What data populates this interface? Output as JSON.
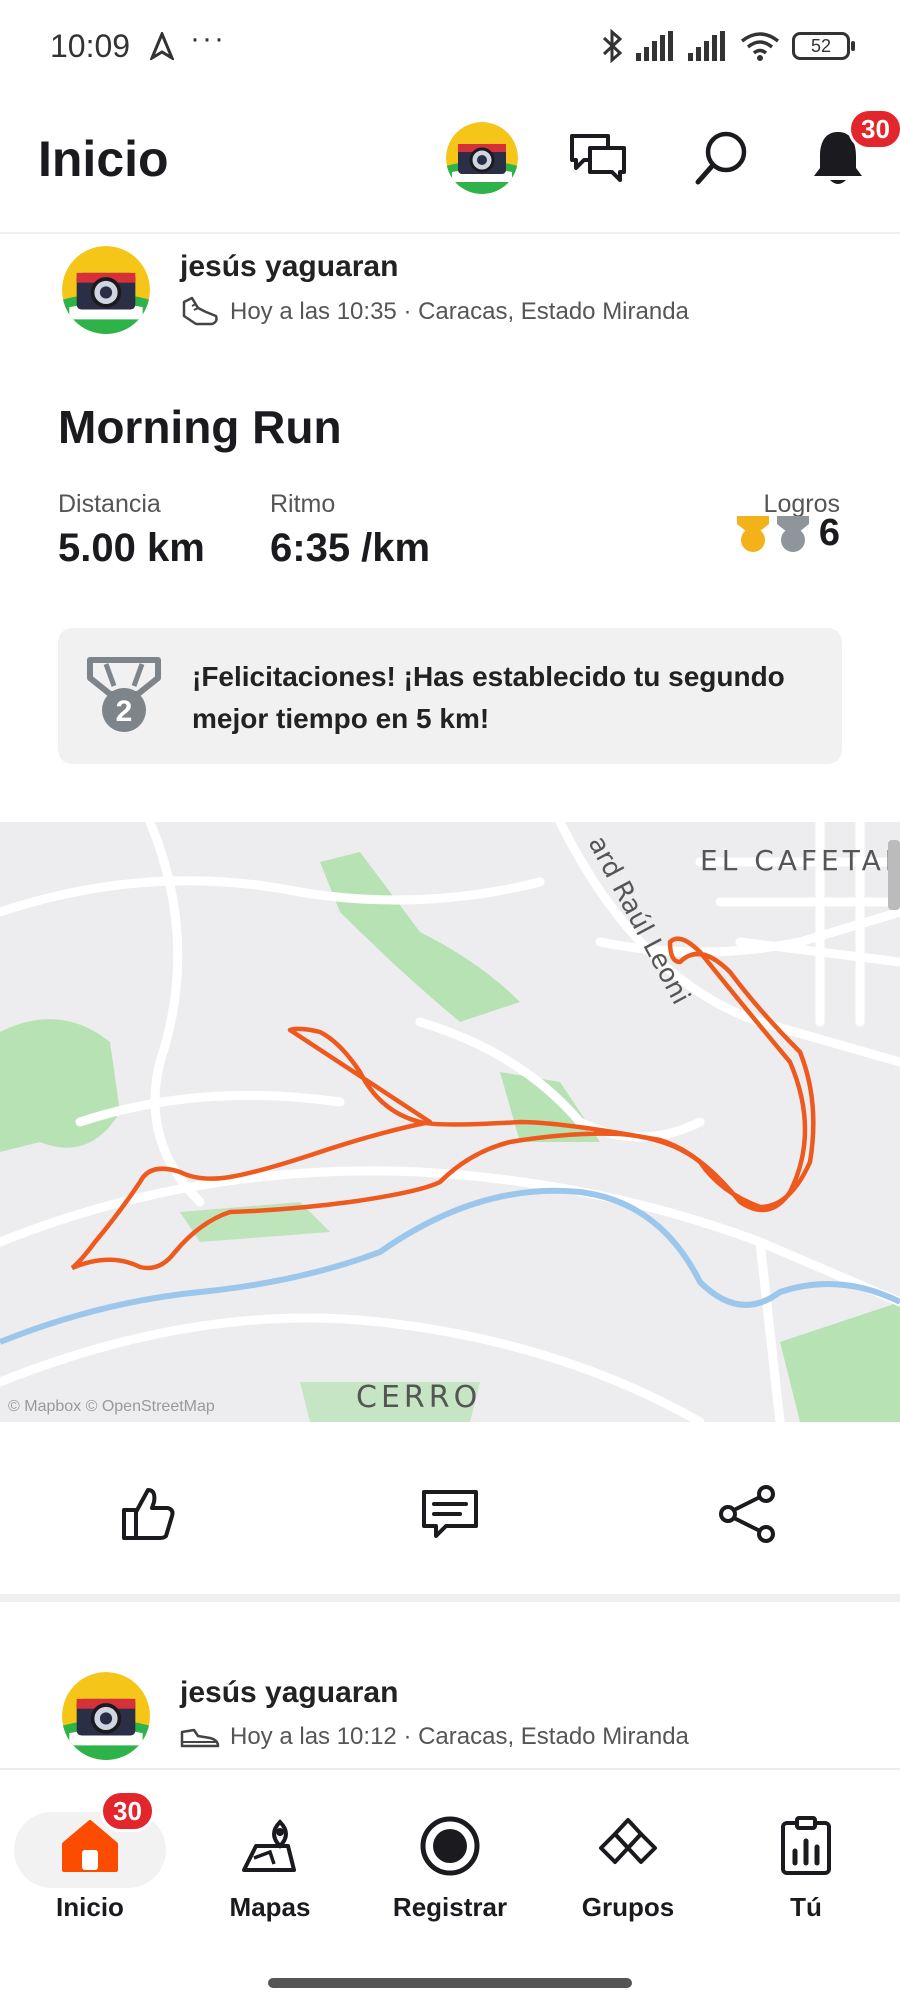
{
  "status_bar": {
    "time": "10:09",
    "dots": "···",
    "battery": "52"
  },
  "header": {
    "title": "Inicio",
    "notification_count": "30"
  },
  "post": {
    "athlete": "jesús yaguaran",
    "meta": "Hoy a las 10:35 · Caracas, Estado Miranda",
    "title": "Morning Run",
    "distance_label": "Distancia",
    "distance_value": "5.00 km",
    "pace_label": "Ritmo",
    "pace_value": "6:35 /km",
    "achievements_label": "Logros",
    "achievements_count": "6",
    "congrats_text": "¡Felicitaciones! ¡Has establecido tu segundo mejor tiempo en 5 km!",
    "medal_number": "2",
    "map": {
      "label_top": "EL CAFETAL",
      "label_street": "ard Raúl Leoni",
      "label_bottom": "CERRO",
      "attribution": "© Mapbox © OpenStreetMap",
      "route_color": "#ee5a1e"
    }
  },
  "next_post": {
    "athlete": "jesús yaguaran",
    "meta": "Hoy a las 10:12 · Caracas, Estado Miranda"
  },
  "bottom_nav": {
    "items": [
      {
        "label": "Inicio",
        "icon": "home-icon",
        "active": true
      },
      {
        "label": "Mapas",
        "icon": "map-icon"
      },
      {
        "label": "Registrar",
        "icon": "record-icon"
      },
      {
        "label": "Grupos",
        "icon": "groups-icon"
      },
      {
        "label": "Tú",
        "icon": "profile-stats-icon"
      }
    ],
    "home_badge": "30"
  },
  "colors": {
    "brand": "#fc4c02",
    "badge": "#e3262b",
    "gold": "#f3b21a",
    "silver": "#8e969c"
  }
}
